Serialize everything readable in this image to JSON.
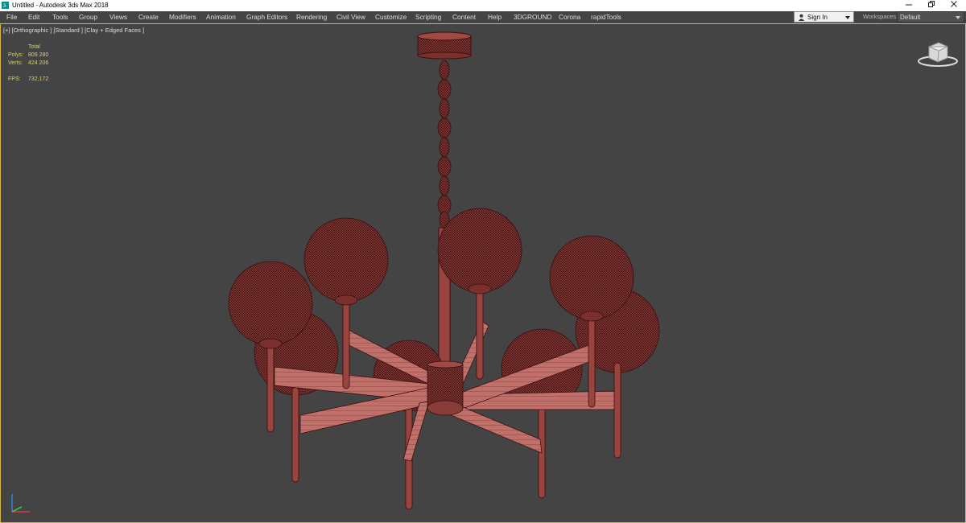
{
  "app": {
    "title": "Untitled - Autodesk 3ds Max 2018"
  },
  "window_controls": [
    "minimize-icon",
    "restore-icon",
    "close-icon"
  ],
  "menu": {
    "items": [
      "File",
      "Edit",
      "Tools",
      "Group",
      "Views",
      "Create",
      "Modifiers",
      "Animation",
      "Graph Editors",
      "Rendering",
      "Civil View",
      "Customize",
      "Scripting",
      "Content",
      "Help",
      "3DGROUND",
      "Corona",
      "rapidTools"
    ]
  },
  "account": {
    "signin_label": "Sign In"
  },
  "workspaces": {
    "label": "Workspaces:",
    "value": "Default"
  },
  "viewport": {
    "label": "[+] [Orthographic ] [Standard ] [Clay + Edged Faces ]",
    "stats": {
      "total_label": "Total",
      "polys_label": "Polys:",
      "polys_value": "809 280",
      "verts_label": "Verts:",
      "verts_value": "424 206",
      "fps_label": "FPS:",
      "fps_value": "732,172"
    }
  },
  "colors": {
    "viewport_bg": "#444444",
    "active_border": "#d7b53a",
    "stats_text": "#e8d23a",
    "model_fill": "#8a3c38",
    "model_wire": "#3a0f10",
    "arm_fill": "#c06f69"
  },
  "icons": {
    "app": "3ds-max-icon",
    "viewcube": "viewcube-icon",
    "axis": "axis-tripod-icon",
    "user": "user-icon"
  }
}
